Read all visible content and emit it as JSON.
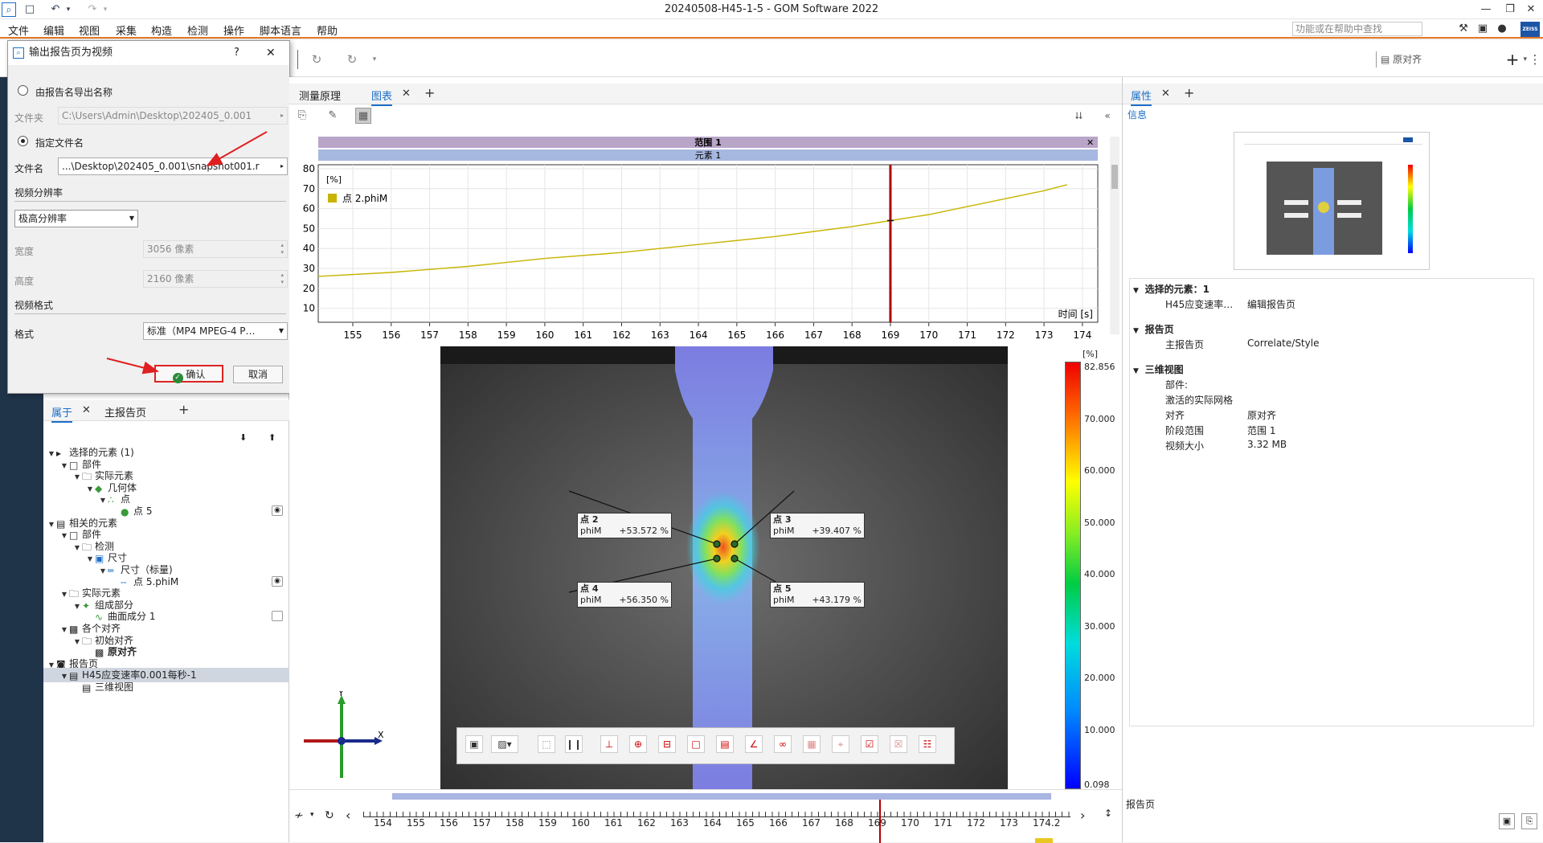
{
  "window": {
    "title": "20240508-H45-1-5 - GOM Software 2022"
  },
  "menu": [
    "文件",
    "编辑",
    "视图",
    "采集",
    "构造",
    "检测",
    "操作",
    "脚本语言",
    "帮助"
  ],
  "help_search": {
    "placeholder": "功能或在帮助中查找"
  },
  "brand": "ZEISS",
  "toolbar": {
    "alignment": "原对齐"
  },
  "dialog": {
    "title": "输出报告页为视频",
    "help": "?",
    "opt_from_report": "由报告名导出名称",
    "folder_label": "文件夹",
    "folder_value": "C:\\Users\\Admin\\Desktop\\202405_0.001",
    "opt_specify": "指定文件名",
    "filename_label": "文件名",
    "filename_value": "...\\Desktop\\202405_0.001\\snapshot001.r",
    "section_resolution": "视频分辨率",
    "resolution_value": "极高分辨率",
    "width_label": "宽度",
    "width_value": "3056 像素",
    "height_label": "高度",
    "height_value": "2160 像素",
    "section_format": "视频格式",
    "format_label": "格式",
    "format_value": "标准（MP4 MPEG-4 P…",
    "ok": "确认",
    "cancel": "取消"
  },
  "left_panel": {
    "tabs": [
      "属于",
      "主报告页"
    ],
    "tree": [
      {
        "level": 0,
        "exp": "▼",
        "icon": "cursor",
        "label": "选择的元素 (1)"
      },
      {
        "level": 1,
        "exp": "▼",
        "icon": "box",
        "label": "部件"
      },
      {
        "level": 2,
        "exp": "▼",
        "icon": "folder",
        "label": "实际元素"
      },
      {
        "level": 3,
        "exp": "▼",
        "icon": "geom",
        "label": "几何体"
      },
      {
        "level": 4,
        "exp": "▼",
        "icon": "dots",
        "label": "点"
      },
      {
        "level": 5,
        "exp": "",
        "icon": "dot",
        "label": "点 5",
        "eye": true
      },
      {
        "level": 0,
        "exp": "▼",
        "icon": "related",
        "label": "相关的元素"
      },
      {
        "level": 1,
        "exp": "▼",
        "icon": "box",
        "label": "部件"
      },
      {
        "level": 2,
        "exp": "▼",
        "icon": "folder",
        "label": "检测"
      },
      {
        "level": 3,
        "exp": "▼",
        "icon": "dim",
        "label": "尺寸"
      },
      {
        "level": 4,
        "exp": "▼",
        "icon": "ruler",
        "label": "尺寸（标量)"
      },
      {
        "level": 5,
        "exp": "",
        "icon": "ruler2",
        "label": "点 5.phiM",
        "eye": true
      },
      {
        "level": 1,
        "exp": "▼",
        "icon": "folder",
        "label": "实际元素"
      },
      {
        "level": 2,
        "exp": "▼",
        "icon": "comp",
        "label": "组成部分"
      },
      {
        "level": 3,
        "exp": "",
        "icon": "surf",
        "label": "曲面成分 1",
        "check": true
      },
      {
        "level": 1,
        "exp": "▼",
        "icon": "align",
        "label": "各个对齐"
      },
      {
        "level": 2,
        "exp": "▼",
        "icon": "folder",
        "label": "初始对齐"
      },
      {
        "level": 3,
        "exp": "",
        "icon": "align",
        "label": "原对齐",
        "bold": true
      },
      {
        "level": 0,
        "exp": "▼",
        "icon": "camera",
        "label": "报告页"
      },
      {
        "level": 1,
        "exp": "▼",
        "icon": "page",
        "label": "H45应变速率0.001每秒-1",
        "sel": true
      },
      {
        "level": 2,
        "exp": "",
        "icon": "page",
        "label": "三维视图"
      }
    ]
  },
  "center": {
    "tabs": [
      "测量原理",
      "图表"
    ],
    "graph": {
      "range_title": "范围 1",
      "element_title": "元素 1",
      "ylabel": "[%]",
      "xlabel": "时间 [s]",
      "legend": "点 2.phiM"
    },
    "points": [
      {
        "name": "点 2",
        "quantity": "phiM",
        "value": "+53.572 %"
      },
      {
        "name": "点 3",
        "quantity": "phiM",
        "value": "+39.407 %"
      },
      {
        "name": "点 4",
        "quantity": "phiM",
        "value": "+56.350 %"
      },
      {
        "name": "点 5",
        "quantity": "phiM",
        "value": "+43.179 %"
      }
    ],
    "legend": {
      "unit": "[%]",
      "values": [
        "82.856",
        "70.000",
        "60.000",
        "50.000",
        "40.000",
        "30.000",
        "20.000",
        "10.000",
        "0.098"
      ]
    },
    "axes": {
      "y": "Y",
      "x": "X"
    },
    "timeline": {
      "ticks": [
        "154",
        "155",
        "156",
        "157",
        "158",
        "159",
        "160",
        "161",
        "162",
        "163",
        "164",
        "165",
        "166",
        "167",
        "168",
        "169",
        "170",
        "171",
        "172",
        "173",
        "174.2"
      ]
    }
  },
  "right_panel": {
    "tabs": [
      "属性"
    ],
    "info": "信息",
    "props": [
      {
        "type": "header",
        "label": "选择的元素：1"
      },
      {
        "type": "kv",
        "k": "H45应变速率…",
        "v": "编辑报告页"
      },
      {
        "type": "header",
        "label": "报告页"
      },
      {
        "type": "kv",
        "k": "主报告页",
        "v": "Correlate/Style"
      },
      {
        "type": "header",
        "label": "三维视图"
      },
      {
        "type": "kv",
        "k": "部件:",
        "v": ""
      },
      {
        "type": "kv",
        "k": "激活的实际网格",
        "v": ""
      },
      {
        "type": "kv",
        "k": "对齐",
        "v": "原对齐"
      },
      {
        "type": "kv",
        "k": "阶段范围",
        "v": "范围 1"
      },
      {
        "type": "kv",
        "k": "视频大小",
        "v": "3.32 MB"
      }
    ],
    "footer": "报告页"
  },
  "chart_data": {
    "type": "line",
    "title": "范围 1",
    "subtitle": "元素 1",
    "xlabel": "时间 [s]",
    "ylabel": "[%]",
    "xlim": [
      154.1,
      174.4
    ],
    "ylim": [
      3,
      82
    ],
    "xticks": [
      155,
      156,
      157,
      158,
      159,
      160,
      161,
      162,
      163,
      164,
      165,
      166,
      167,
      168,
      169,
      170,
      171,
      172,
      173,
      174
    ],
    "yticks": [
      10,
      20,
      30,
      40,
      50,
      60,
      70,
      80
    ],
    "cursor_x": 169,
    "series": [
      {
        "name": "点 2.phiM",
        "color": "#c8b400",
        "x": [
          154.1,
          156,
          158,
          160,
          162,
          164,
          166,
          168,
          169,
          170,
          171,
          172,
          173,
          173.6
        ],
        "y": [
          26,
          28,
          31,
          35,
          38,
          42,
          46,
          51,
          54,
          57,
          61,
          65,
          69,
          72
        ]
      }
    ]
  }
}
